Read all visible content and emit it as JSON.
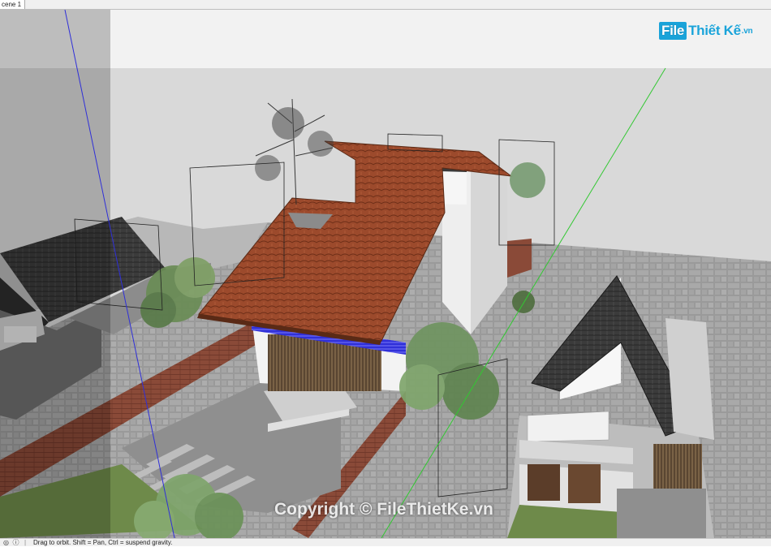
{
  "scene_tabs": [
    {
      "label": "cene 1"
    }
  ],
  "watermark": {
    "logo_box": "File",
    "logo_rest": "Thiết Kế",
    "logo_suffix": ".vn"
  },
  "copyright": "Copyright © FileThietKe.vn",
  "statusbar": {
    "icons": [
      "globe-icon",
      "info-icon"
    ],
    "message": "Drag to orbit. Shift = Pan, Ctrl = suspend gravity."
  },
  "colors": {
    "roof_tile": "#9c4a2c",
    "dark_roof": "#3a3a3a",
    "grass": "#6e8a4a",
    "brick": "#8a4a38",
    "axis_green": "#32c832",
    "axis_blue": "#2f2fd8"
  }
}
